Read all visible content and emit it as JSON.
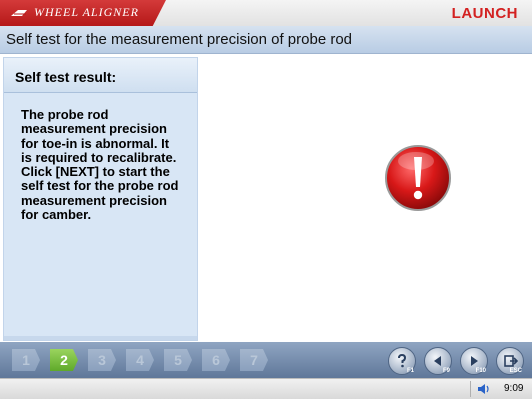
{
  "header": {
    "brand": "WHEEL ALIGNER",
    "logo": "LAUNCH",
    "brand_color": "#c62828"
  },
  "title": "Self test for the measurement precision of probe rod",
  "result": {
    "heading": "Self test result:",
    "message": "The probe rod measurement precision for toe-in is abnormal. It is required to recalibrate. Click [NEXT] to start the self test for the probe rod measurement precision for camber."
  },
  "warning": {
    "icon": "exclamation-warning-icon",
    "color": "#d81818"
  },
  "steps": [
    {
      "label": "1",
      "active": false
    },
    {
      "label": "2",
      "active": true
    },
    {
      "label": "3",
      "active": false
    },
    {
      "label": "4",
      "active": false
    },
    {
      "label": "5",
      "active": false
    },
    {
      "label": "6",
      "active": false
    },
    {
      "label": "7",
      "active": false
    }
  ],
  "controls": [
    {
      "name": "help-button",
      "icon": "question-icon",
      "key": "F1"
    },
    {
      "name": "back-button",
      "icon": "back-arrow-icon",
      "key": "F9"
    },
    {
      "name": "next-button",
      "icon": "next-arrow-icon",
      "key": "F10"
    },
    {
      "name": "exit-button",
      "icon": "exit-icon",
      "key": "ESC"
    }
  ],
  "status": {
    "time": "9:09",
    "speaker_icon": "speaker-icon"
  }
}
